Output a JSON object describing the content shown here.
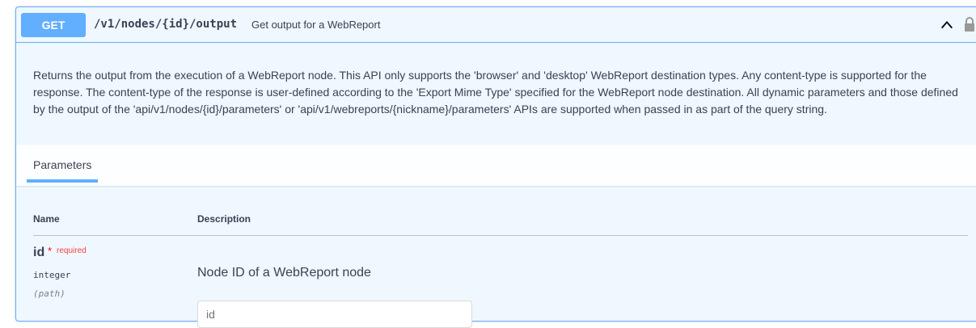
{
  "operation": {
    "method": "GET",
    "path": "/v1/nodes/{id}/output",
    "summary": "Get output for a WebReport",
    "description": "Returns the output from the execution of a WebReport node. This API only supports the 'browser' and 'desktop' WebReport destination types. Any content-type is supported for the response. The content-type of the response is user-defined according to the 'Export Mime Type' specified for the WebReport node destination. All dynamic parameters and those defined by the output of the 'api/v1/nodes/{id}/parameters' or 'api/v1/webreports/{nickname}/parameters' APIs are supported when passed in as part of the query string.",
    "method_color": "#61affe"
  },
  "parameters": {
    "tab_label": "Parameters",
    "columns": {
      "name": "Name",
      "description": "Description"
    },
    "items": [
      {
        "name": "id",
        "required_star": "*",
        "required_label": "required",
        "type": "integer",
        "in": "(path)",
        "description": "Node ID of a WebReport node",
        "input_placeholder": "id"
      }
    ]
  },
  "icons": {
    "collapse": "chevron-up-icon",
    "auth": "lock-icon"
  }
}
